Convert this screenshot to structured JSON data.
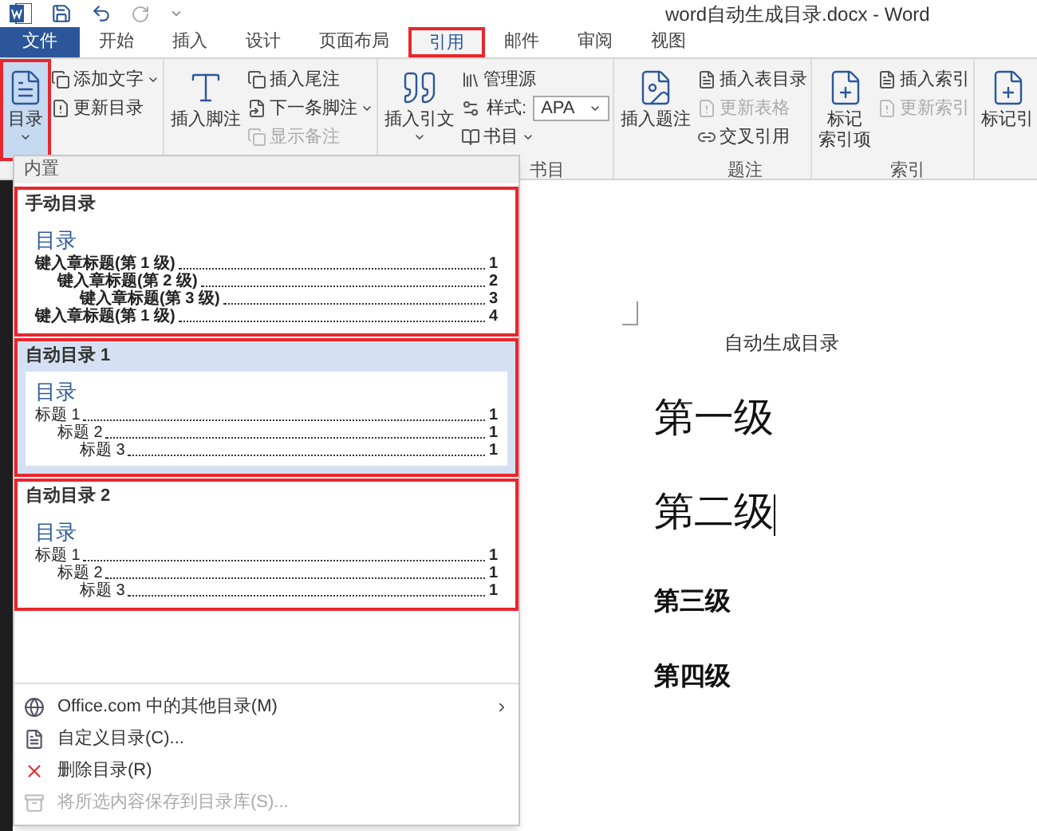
{
  "title_bar": {
    "title": "word自动生成目录.docx - Word"
  },
  "tabs": [
    {
      "label": "文件",
      "kind": "file",
      "selected": false,
      "highlighted": false
    },
    {
      "label": "开始",
      "kind": "tab",
      "selected": false,
      "highlighted": false
    },
    {
      "label": "插入",
      "kind": "tab",
      "selected": false,
      "highlighted": false
    },
    {
      "label": "设计",
      "kind": "tab",
      "selected": false,
      "highlighted": false
    },
    {
      "label": "页面布局",
      "kind": "tab",
      "selected": false,
      "highlighted": false
    },
    {
      "label": "引用",
      "kind": "tab",
      "selected": true,
      "highlighted": true
    },
    {
      "label": "邮件",
      "kind": "tab",
      "selected": false,
      "highlighted": false
    },
    {
      "label": "审阅",
      "kind": "tab",
      "selected": false,
      "highlighted": false
    },
    {
      "label": "视图",
      "kind": "tab",
      "selected": false,
      "highlighted": false
    }
  ],
  "ribbon": {
    "groups": [
      {
        "large": [
          {
            "label": "目录",
            "dropdown": true,
            "pressed": true,
            "highlighted": true
          }
        ],
        "small": [
          {
            "kind": "button",
            "label": "添加文字",
            "dropdown": true,
            "disabled": false
          },
          {
            "kind": "button",
            "label": "更新目录",
            "dropdown": false,
            "disabled": false
          }
        ]
      },
      {
        "large": [
          {
            "label": "插入脚注",
            "dropdown": false,
            "pressed": false,
            "highlighted": false
          }
        ],
        "small": [
          {
            "kind": "button",
            "label": "插入尾注",
            "dropdown": false,
            "disabled": false
          },
          {
            "kind": "button",
            "label": "下一条脚注",
            "dropdown": true,
            "disabled": false
          },
          {
            "kind": "button",
            "label": "显示备注",
            "dropdown": false,
            "disabled": true
          }
        ]
      },
      {
        "label": "书目",
        "large": [
          {
            "label": "插入引文",
            "dropdown": true,
            "pressed": false,
            "highlighted": false
          }
        ],
        "small": [
          {
            "kind": "button",
            "label": "管理源",
            "dropdown": false,
            "disabled": false
          },
          {
            "kind": "select",
            "label": "样式:",
            "value": "APA"
          },
          {
            "kind": "button",
            "label": "书目",
            "dropdown": true,
            "disabled": false
          }
        ]
      },
      {
        "label": "题注",
        "large": [
          {
            "label": "插入题注",
            "dropdown": false,
            "pressed": false,
            "highlighted": false
          }
        ],
        "small": [
          {
            "kind": "button",
            "label": "插入表目录",
            "dropdown": false,
            "disabled": false
          },
          {
            "kind": "button",
            "label": "更新表格",
            "dropdown": false,
            "disabled": true
          },
          {
            "kind": "button",
            "label": "交叉引用",
            "dropdown": false,
            "disabled": false
          }
        ]
      },
      {
        "label": "索引",
        "large": [
          {
            "label": "标记",
            "label_2": "索引项",
            "dropdown": false,
            "pressed": false,
            "highlighted": false
          }
        ],
        "small": [
          {
            "kind": "button",
            "label": "插入索引",
            "dropdown": false,
            "disabled": false
          },
          {
            "kind": "button",
            "label": "更新索引",
            "dropdown": false,
            "disabled": true
          }
        ]
      },
      {
        "large": [
          {
            "label": "标记引",
            "dropdown": false,
            "pressed": false,
            "highlighted": false
          }
        ]
      }
    ]
  },
  "toc_menu": {
    "section": "内置",
    "gallery": [
      {
        "title": "手动目录",
        "hovered": false,
        "highlighted": true,
        "preview": {
          "heading": "目录",
          "bold": true,
          "entries": [
            {
              "text": "键入章标题(第 1 级)",
              "page": "1",
              "children": [
                {
                  "text": "键入章标题(第 2 级)",
                  "page": "2",
                  "children": [
                    {
                      "text": "键入章标题(第 3 级)",
                      "page": "3"
                    }
                  ]
                }
              ]
            },
            {
              "text": "键入章标题(第 1 级)",
              "page": "4"
            }
          ]
        }
      },
      {
        "title": "自动目录 1",
        "hovered": true,
        "highlighted": true,
        "preview": {
          "heading": "目录",
          "bold": false,
          "entries": [
            {
              "text": "标题 1",
              "page": "1",
              "children": [
                {
                  "text": "标题 2",
                  "page": "1",
                  "children": [
                    {
                      "text": "标题 3",
                      "page": "1"
                    }
                  ]
                }
              ]
            }
          ]
        }
      },
      {
        "title": "自动目录 2",
        "hovered": false,
        "highlighted": true,
        "preview": {
          "heading": "目录",
          "bold": false,
          "entries": [
            {
              "text": "标题 1",
              "page": "1",
              "children": [
                {
                  "text": "标题 2",
                  "page": "1",
                  "children": [
                    {
                      "text": "标题 3",
                      "page": "1"
                    }
                  ]
                }
              ]
            }
          ]
        }
      }
    ],
    "commands": [
      {
        "label": "Office.com 中的其他目录(M)",
        "submenu": true,
        "disabled": false
      },
      {
        "label": "自定义目录(C)...",
        "submenu": false,
        "disabled": false
      },
      {
        "label": "删除目录(R)",
        "submenu": false,
        "disabled": false
      },
      {
        "label": "将所选内容保存到目录库(S)...",
        "submenu": false,
        "disabled": true
      }
    ]
  },
  "document": {
    "title": "自动生成目录",
    "headings": [
      {
        "text": "第一级",
        "kind": "heading1",
        "cursor": false
      },
      {
        "text": "第二级",
        "kind": "heading1",
        "cursor": true
      },
      {
        "text": "第三级",
        "kind": "heading2",
        "cursor": false
      },
      {
        "text": "第四级",
        "kind": "heading2",
        "cursor": false
      }
    ]
  }
}
